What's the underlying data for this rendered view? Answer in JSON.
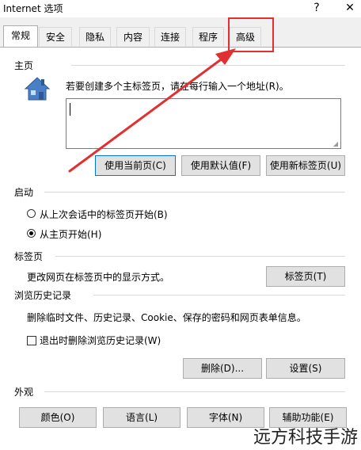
{
  "window": {
    "title": "Internet 选项",
    "help_label": "?",
    "close_label": "✕"
  },
  "tabs": [
    {
      "label": "常规"
    },
    {
      "label": "安全"
    },
    {
      "label": "隐私"
    },
    {
      "label": "内容"
    },
    {
      "label": "连接"
    },
    {
      "label": "程序"
    },
    {
      "label": "高级"
    }
  ],
  "home": {
    "section_title": "主页",
    "instruction": "若要创建多个主标签页，请在每行输入一个地址(R)。",
    "url_value": "",
    "btn_current": "使用当前页(C)",
    "btn_default": "使用默认值(F)",
    "btn_newtab": "使用新标签页(U)"
  },
  "startup": {
    "section_title": "启动",
    "opt_last_session": "从上次会话中的标签页开始(B)",
    "opt_home": "从主页开始(H)"
  },
  "tabs_section": {
    "section_title": "标签页",
    "description": "更改网页在标签页中的显示方式。",
    "button": "标签页(T)"
  },
  "history": {
    "section_title": "浏览历史记录",
    "description": "删除临时文件、历史记录、Cookie、保存的密码和网页表单信息。",
    "checkbox_label": "退出时删除浏览历史记录(W)",
    "delete_button": "删除(D)...",
    "settings_button": "设置(S)"
  },
  "appearance": {
    "section_title": "外观",
    "colors_button": "颜色(O)",
    "languages_button": "语言(L)",
    "fonts_button": "字体(N)",
    "accessibility_button": "辅助功能(E)"
  },
  "watermark": "远方科技手游",
  "colors": {
    "annotation_red": "#e23030",
    "focus_blue": "#0078d7"
  }
}
